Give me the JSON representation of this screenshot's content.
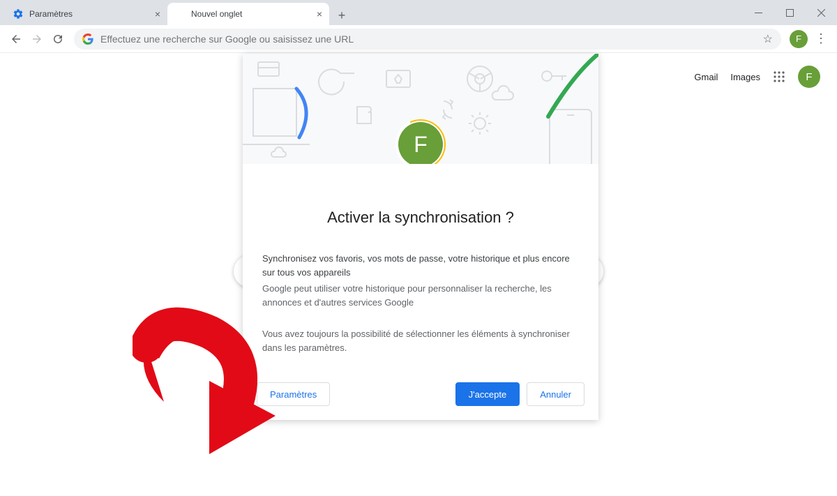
{
  "tabs": [
    {
      "title": "Paramètres",
      "active": false
    },
    {
      "title": "Nouvel onglet",
      "active": true
    }
  ],
  "omnibox": {
    "placeholder": "Effectuez une recherche sur Google ou saisissez une URL"
  },
  "profile": {
    "initial": "F",
    "color": "#689f38"
  },
  "ntp": {
    "gmail": "Gmail",
    "images": "Images"
  },
  "dialog": {
    "title": "Activer la synchronisation ?",
    "line1": "Synchronisez vos favoris, vos mots de passe, votre historique et plus encore sur tous vos appareils",
    "line2": "Google peut utiliser votre historique pour personnaliser la recherche, les annonces et d'autres services Google",
    "line3": "Vous avez toujours la possibilité de sélectionner les éléments à synchroniser dans les paramètres.",
    "settings_btn": "Paramètres",
    "accept_btn": "J'accepte",
    "cancel_btn": "Annuler"
  }
}
